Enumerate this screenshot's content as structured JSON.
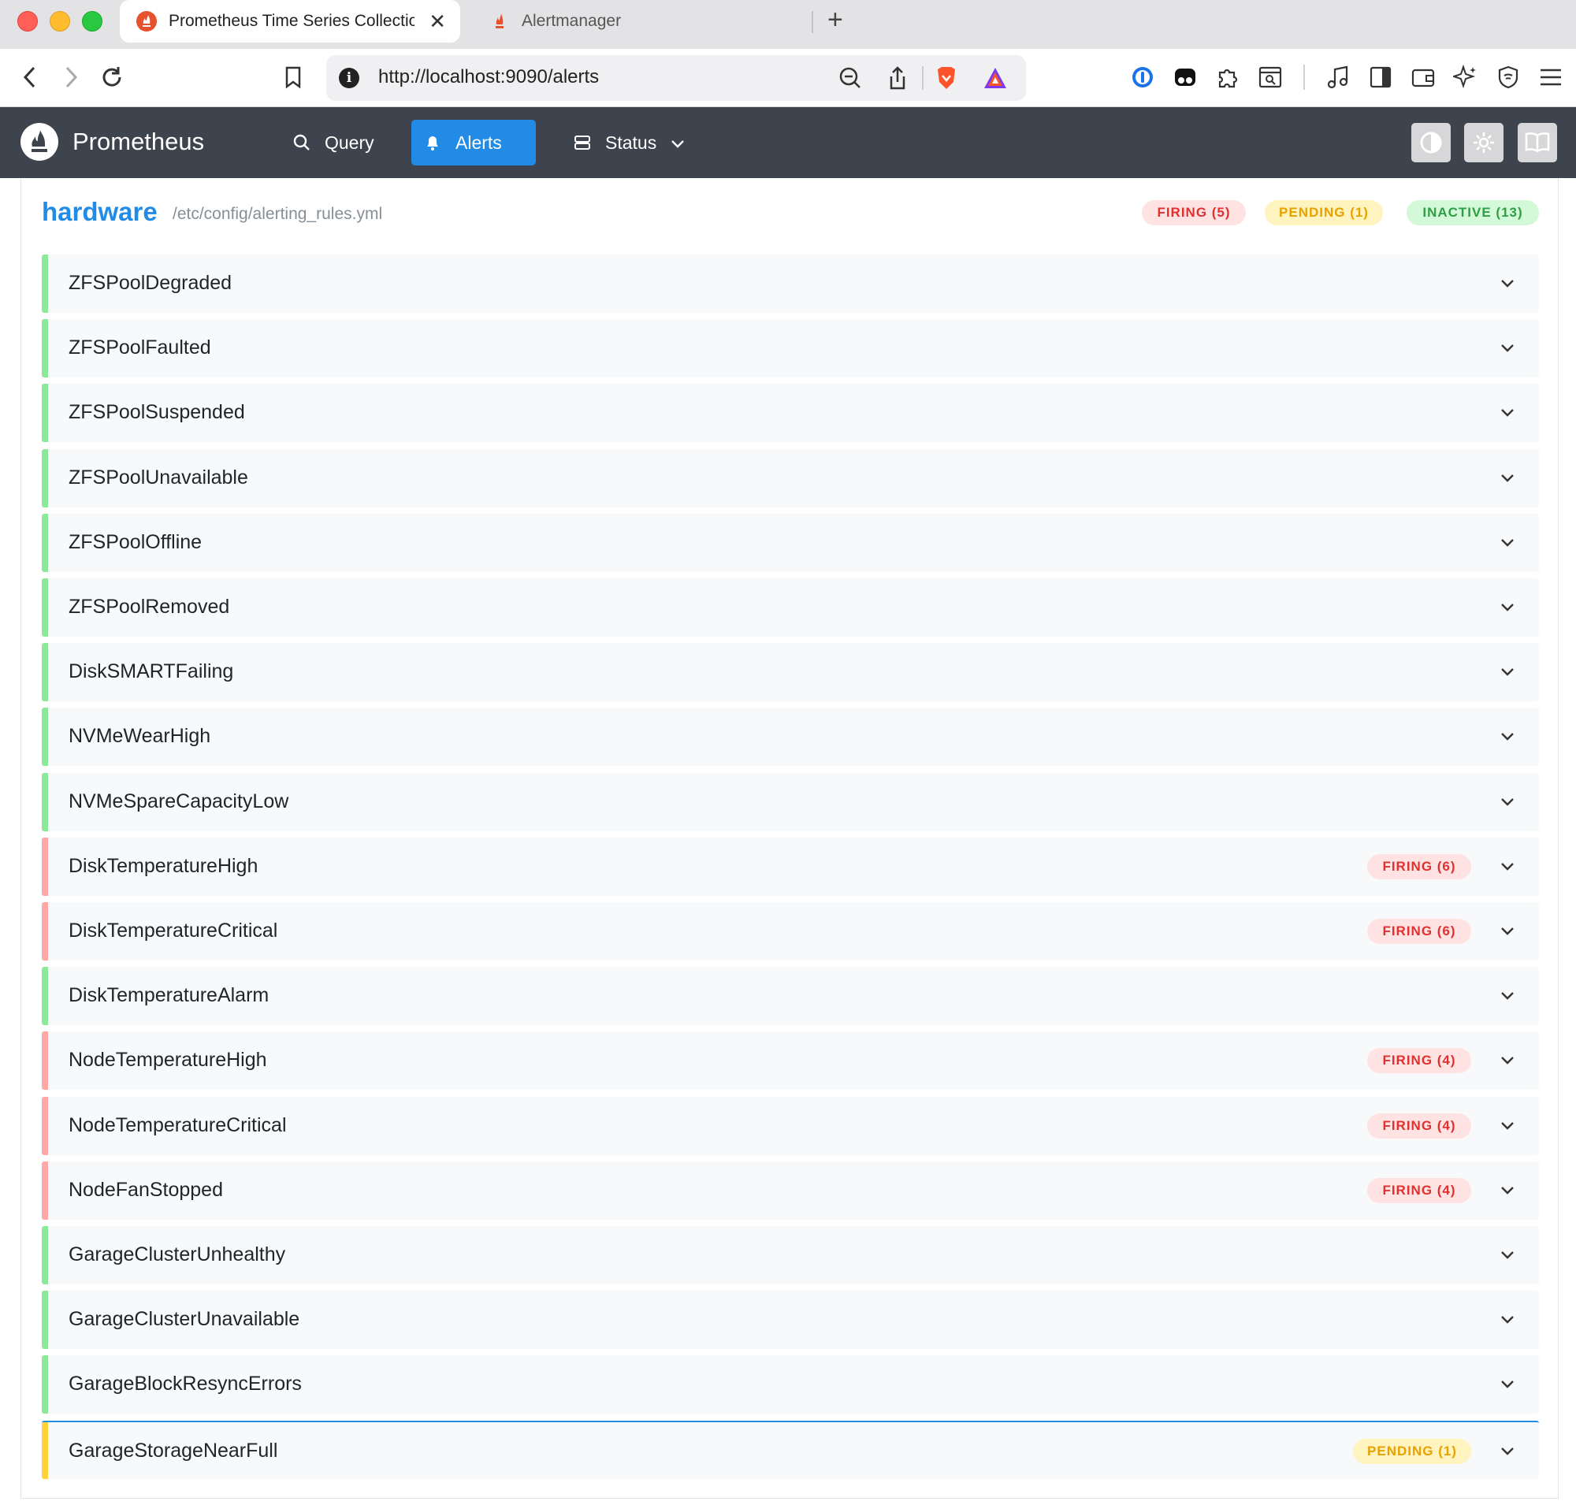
{
  "browser": {
    "tabs": [
      {
        "title": "Prometheus Time Series Collection",
        "active": true
      },
      {
        "title": "Alertmanager",
        "active": false
      }
    ],
    "url": "http://localhost:9090/alerts"
  },
  "navbar": {
    "brand": "Prometheus",
    "links": {
      "query": "Query",
      "alerts": "Alerts",
      "status": "Status"
    },
    "active": "Alerts",
    "accent_color": "#228be6"
  },
  "group": {
    "name": "hardware",
    "file": "/etc/config/alerting_rules.yml",
    "summary": {
      "firing": "FIRING (5)",
      "pending": "PENDING (1)",
      "inactive": "INACTIVE (13)"
    }
  },
  "rules": [
    {
      "name": "ZFSPoolDegraded",
      "state": "inactive",
      "badge": ""
    },
    {
      "name": "ZFSPoolFaulted",
      "state": "inactive",
      "badge": ""
    },
    {
      "name": "ZFSPoolSuspended",
      "state": "inactive",
      "badge": ""
    },
    {
      "name": "ZFSPoolUnavailable",
      "state": "inactive",
      "badge": ""
    },
    {
      "name": "ZFSPoolOffline",
      "state": "inactive",
      "badge": ""
    },
    {
      "name": "ZFSPoolRemoved",
      "state": "inactive",
      "badge": ""
    },
    {
      "name": "DiskSMARTFailing",
      "state": "inactive",
      "badge": ""
    },
    {
      "name": "NVMeWearHigh",
      "state": "inactive",
      "badge": ""
    },
    {
      "name": "NVMeSpareCapacityLow",
      "state": "inactive",
      "badge": ""
    },
    {
      "name": "DiskTemperatureHigh",
      "state": "firing",
      "badge": "FIRING (6)"
    },
    {
      "name": "DiskTemperatureCritical",
      "state": "firing",
      "badge": "FIRING (6)"
    },
    {
      "name": "DiskTemperatureAlarm",
      "state": "inactive",
      "badge": ""
    },
    {
      "name": "NodeTemperatureHigh",
      "state": "firing",
      "badge": "FIRING (4)"
    },
    {
      "name": "NodeTemperatureCritical",
      "state": "firing",
      "badge": "FIRING (4)"
    },
    {
      "name": "NodeFanStopped",
      "state": "firing",
      "badge": "FIRING (4)"
    },
    {
      "name": "GarageClusterUnhealthy",
      "state": "inactive",
      "badge": ""
    },
    {
      "name": "GarageClusterUnavailable",
      "state": "inactive",
      "badge": ""
    },
    {
      "name": "GarageBlockResyncErrors",
      "state": "inactive",
      "badge": ""
    },
    {
      "name": "GarageStorageNearFull",
      "state": "pending",
      "badge": "PENDING (1)"
    }
  ],
  "colors": {
    "firing": "#e03131",
    "pending": "#e8a100",
    "inactive": "#2f9e44"
  }
}
